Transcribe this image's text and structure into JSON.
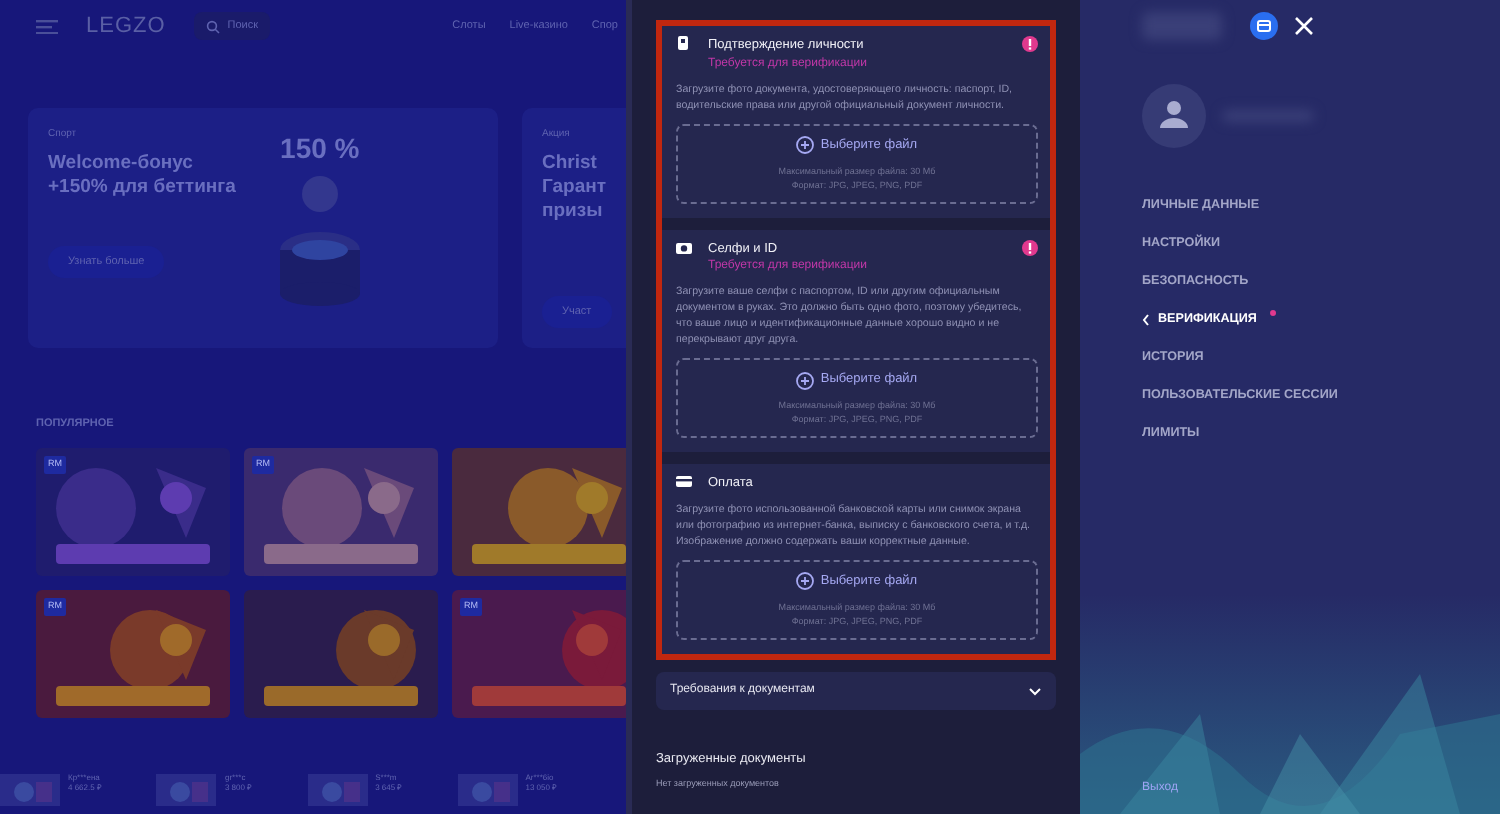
{
  "background_site": {
    "logo": "LEGZO",
    "search": {
      "placeholder": "Поиск"
    },
    "nav": [
      "Слоты",
      "Live-казино",
      "Спор"
    ],
    "banners": [
      {
        "category": "Спорт",
        "title_lines": [
          "Welcome-бонус",
          "+150% для беттинга"
        ],
        "badge": "150 %",
        "button": "Узнать больше"
      },
      {
        "category": "Акция",
        "title_lines": [
          "Christ",
          "Гарант",
          "призы"
        ],
        "button": "Участ"
      }
    ],
    "section_title": "ПОПУЛЯРНОЕ",
    "games": [
      {
        "kind": "picture",
        "badge": "RM"
      },
      {
        "kind": "picture",
        "badge": "RM"
      },
      {
        "kind": "picture"
      },
      {
        "kind": "picture",
        "badge": "RM"
      },
      {
        "kind": "picture"
      },
      {
        "kind": "picture",
        "badge": "RM"
      }
    ],
    "winners": [
      {
        "name": "Кр***ена",
        "amount": "4 662.5 ₽"
      },
      {
        "name": "gr***c",
        "amount": "3 800 ₽"
      },
      {
        "name": "S***m",
        "amount": "3 645 ₽"
      },
      {
        "name": "Ar***6io",
        "amount": "13 050 ₽"
      }
    ]
  },
  "documents": [
    {
      "kind": "id",
      "title": "Подтверждение личности",
      "status": "Требуется для верификации",
      "alert": true,
      "description": "Загрузите фото документа, удостоверяющего личность: паспорт, ID, водительские права или другой официальный документ личности.",
      "upload": {
        "button": "Выберите файл",
        "max_size": "Максимальный размер файла: 30 Мб",
        "formats": "Формат: JPG, JPEG, PNG, PDF"
      }
    },
    {
      "kind": "camera",
      "title": "Селфи и ID",
      "status": "Требуется для верификации",
      "alert": true,
      "description": "Загрузите ваше селфи с паспортом, ID или другим официальным документом в руках. Это должно быть одно фото, поэтому убедитесь, что ваше лицо и идентификационные данные хорошо видно и не перекрывают друг друга.",
      "upload": {
        "button": "Выберите файл",
        "max_size": "Максимальный размер файла: 30 Мб",
        "formats": "Формат: JPG, JPEG, PNG, PDF"
      }
    },
    {
      "kind": "card",
      "title": "Оплата",
      "alert": false,
      "description": "Загрузите фото использованной банковской карты или снимок экрана или фотографию из интернет-банка, выписку с банковского счета, и т.д. Изображение должно содержать ваши корректные данные.",
      "upload": {
        "button": "Выберите файл",
        "max_size": "Максимальный размер файла: 30 Мб",
        "formats": "Формат: JPG, JPEG, PNG, PDF"
      }
    }
  ],
  "requirements": {
    "label": "Требования к документам",
    "expanded": false
  },
  "uploaded": {
    "title": "Загруженные документы",
    "empty_text": "Нет загруженных документов"
  },
  "profile": {
    "menu": [
      {
        "label": "ЛИЧНЫЕ ДАННЫЕ",
        "selected": false,
        "alert": false
      },
      {
        "label": "НАСТРОЙКИ",
        "selected": false,
        "alert": false
      },
      {
        "label": "БЕЗОПАСНОСТЬ",
        "selected": false,
        "alert": false
      },
      {
        "label": "ВЕРИФИКАЦИЯ",
        "selected": true,
        "alert": true
      },
      {
        "label": "ИСТОРИЯ",
        "selected": false,
        "alert": false
      },
      {
        "label": "ПОЛЬЗОВАТЕЛЬСКИЕ СЕССИИ",
        "selected": false,
        "alert": false
      },
      {
        "label": "ЛИМИТЫ",
        "selected": false,
        "alert": false
      }
    ],
    "logout": "Выход"
  }
}
